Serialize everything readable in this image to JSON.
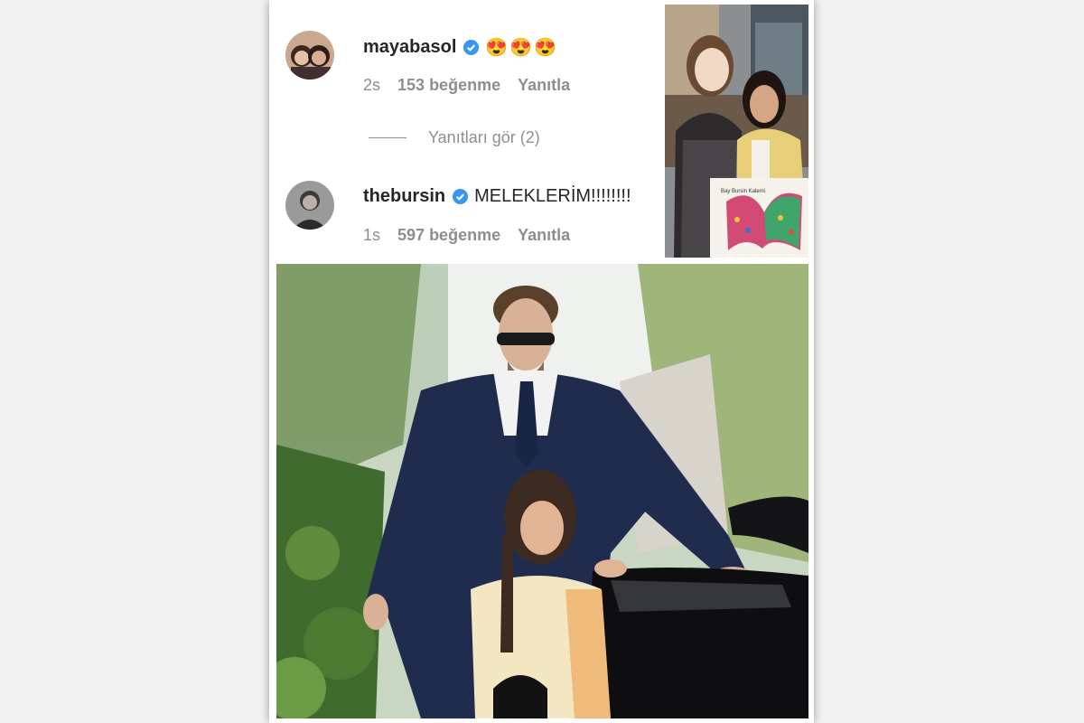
{
  "comments": [
    {
      "username": "mayabasol",
      "text": "",
      "emoji": "😍😍😍",
      "age": "2s",
      "likes": "153 beğenme",
      "reply": "Yanıtla"
    },
    {
      "username": "thebursin",
      "text": "MELEKLERİM!!!!!!!!",
      "age": "1s",
      "likes": "597 beğenme",
      "reply": "Yanıtla"
    }
  ],
  "view_replies": "Yanıtları gör (2)",
  "drawing_text": "Bay Bursin Kalemi",
  "colors": {
    "text": "#262626",
    "muted": "#8e8e8e",
    "verified": "#3897f0"
  },
  "icons": [
    "verified-badge-icon",
    "heart-eyes-emoji"
  ]
}
